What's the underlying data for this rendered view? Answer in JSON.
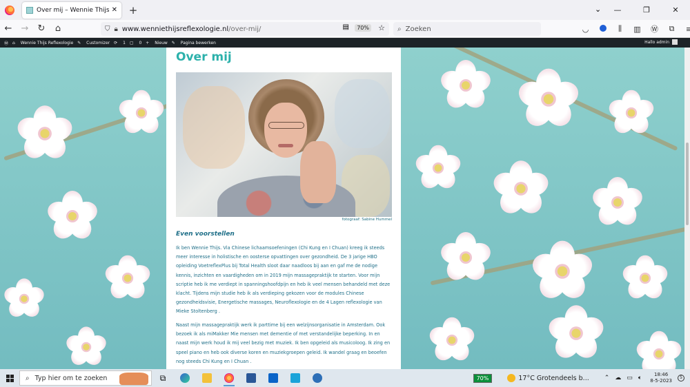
{
  "browser": {
    "tab": {
      "title": "Over mij – Wennie Thijs Reflexolo",
      "close": "✕"
    },
    "new_tab": "+",
    "tab_list": "⌄",
    "window_controls": {
      "minimize": "—",
      "maximize": "❐",
      "close": "✕"
    },
    "nav": {
      "back": "←",
      "forward": "→",
      "reload": "↻",
      "home": "⌂"
    },
    "url": {
      "host": "www.wenniethijsreflexologie.nl",
      "path": "/over-mij/"
    },
    "zoom": "70%",
    "search_placeholder": "Zoeken",
    "toolbar_icons": [
      "pocket-icon",
      "account-icon",
      "library-icon",
      "sidebar-icon",
      "wikipedia-icon",
      "extensions-icon",
      "menu-icon"
    ]
  },
  "wp_admin_bar": {
    "site_name": "Wennie Thijs Reflexologie",
    "customizer": "Customizer",
    "updates_count": "1",
    "comments_count": "0",
    "new": "Nieuw",
    "edit_page": "Pagina bewerken",
    "greeting": "Hallo admin"
  },
  "page": {
    "title": "Over mij",
    "photo_caption": "fotograaf: Sabine Hummel",
    "subtitle": "Even voorstellen",
    "paragraph1": "Ik ben Wennie Thijs. Via Chinese lichaamsoefeningen (Chi Kung en I Chuan) kreeg ik steeds meer interesse in holistische en oosterse opvattingen over gezondheid. De 3 jarige HBO opleiding VoetreflexPlus bij Total Health sloot daar naadloos bij aan en gaf me de nodige kennis, inzichten en vaardigheden om in 2019 mijn massagepraktijk te starten. Voor mijn scriptie heb ik me verdiept in spanningshoofdpijn en heb ik veel mensen behandeld met deze klacht. Tijdens mijn studie  heb ik als verdieping gekozen voor de modules Chinese gezondheidsvisie, Energetische massages, Neuroflexologie en  de 4 Lagen reflexologie van Mieke Stoltenberg .",
    "paragraph2": "Naast mijn massagepraktijk werk ik parttime bij een welzijnsorganisatie in Amsterdam. Ook bezoek ik als miMakker Mie mensen met dementie of met verstandelijke beperking. In en naast mijn werk houd ik mij veel bezig met muziek. Ik ben opgeleid als musicoloog. Ik zing en speel piano en heb ook diverse koren en muziekgroepen geleid. Ik wandel graag en beoefen nog steeds Chi Kung en I Chuan ."
  },
  "taskbar": {
    "search_placeholder": "Typ hier om te zoeken",
    "apps": [
      "task-view",
      "edge",
      "file-explorer",
      "firefox",
      "word",
      "store",
      "l-app",
      "browser-app"
    ],
    "battery": "70%",
    "weather": "17°C  Grotendeels b...",
    "time": "18:46",
    "date": "8-5-2023",
    "notifications": "5"
  },
  "colors": {
    "accent": "#2cb1ab",
    "text": "#1f6f88",
    "wp_bar": "#1d2327"
  }
}
